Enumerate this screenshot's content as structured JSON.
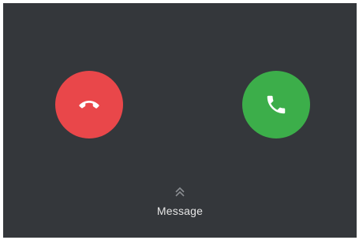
{
  "call_screen": {
    "decline_icon": "phone-hangup-icon",
    "accept_icon": "phone-icon",
    "decline_color": "#e9474a",
    "accept_color": "#3cae4a",
    "background_color": "#34373b"
  },
  "message": {
    "label": "Message",
    "icon": "double-chevron-up-icon"
  }
}
